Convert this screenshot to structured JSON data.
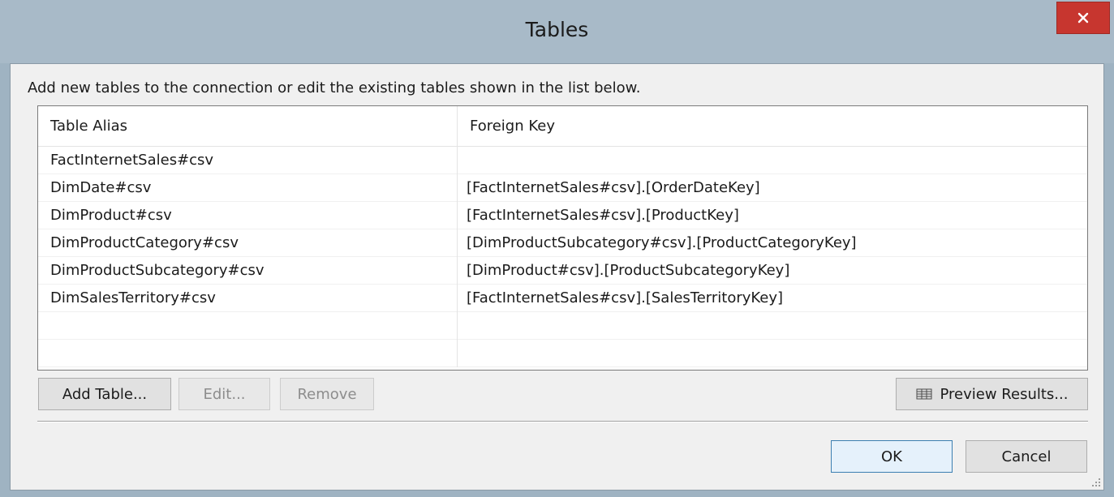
{
  "window": {
    "title": "Tables",
    "close_icon": "close-icon"
  },
  "description": "Add new tables to the connection or edit the existing tables shown in the list below.",
  "table": {
    "columns": [
      "Table Alias",
      "Foreign Key"
    ],
    "rows": [
      {
        "alias": "FactInternetSales#csv",
        "fk": ""
      },
      {
        "alias": "DimDate#csv",
        "fk": "[FactInternetSales#csv].[OrderDateKey]"
      },
      {
        "alias": "DimProduct#csv",
        "fk": "[FactInternetSales#csv].[ProductKey]"
      },
      {
        "alias": "DimProductCategory#csv",
        "fk": "[DimProductSubcategory#csv].[ProductCategoryKey]"
      },
      {
        "alias": "DimProductSubcategory#csv",
        "fk": "[DimProduct#csv].[ProductSubcategoryKey]"
      },
      {
        "alias": "DimSalesTerritory#csv",
        "fk": "[FactInternetSales#csv].[SalesTerritoryKey]"
      },
      {
        "alias": "",
        "fk": ""
      },
      {
        "alias": "",
        "fk": ""
      }
    ]
  },
  "buttons": {
    "add_table": "Add Table...",
    "edit": "Edit...",
    "remove": "Remove",
    "preview_results": "Preview Results...",
    "preview_icon": "table-grid-icon",
    "ok": "OK",
    "cancel": "Cancel"
  },
  "colors": {
    "titlebar": "#a8bac8",
    "close_button": "#c7362f",
    "client_bg": "#f0f0f0"
  }
}
